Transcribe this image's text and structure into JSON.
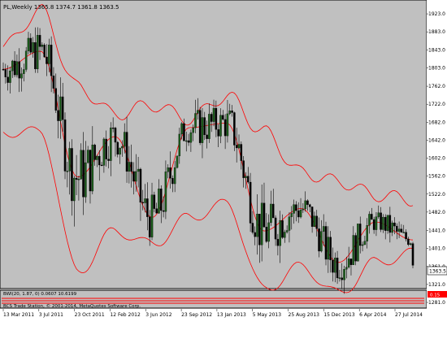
{
  "window": {
    "header": "PL,Weekly  1365.8 1374.7 1361.8 1363.5"
  },
  "indicator": {
    "header": "BWI(20, 1.87, 0) 0.0607 10.6199",
    "copyright": "BCS Trade Station, © 2001-2014, MetaQuotes Software Corp.",
    "value_badge": "0.15"
  },
  "price_axis": {
    "labels": [
      "1923.0",
      "1883.0",
      "1843.0",
      "1803.0",
      "1762.0",
      "1722.0",
      "1682.0",
      "1642.0",
      "1602.0",
      "1562.0",
      "1522.0",
      "1482.0",
      "1441.0",
      "1401.0",
      "1361.0",
      "1321.0",
      "1281.0"
    ],
    "current_price": "1363.5"
  },
  "time_axis": {
    "labels": [
      "13 Mar 2011",
      "3 Jul 2011",
      "23 Oct 2011",
      "12 Feb 2012",
      "3 Jun 2012",
      "23 Sep 2012",
      "13 Jan 2013",
      "5 May 2013",
      "25 Aug 2013",
      "15 Dec 2013",
      "6 Apr 2014",
      "27 Jul 2014"
    ]
  },
  "colors": {
    "background": "#c0c0c0",
    "bull_candle": "#00ff00",
    "bear_candle": "#ff0000",
    "bands": "#ff0000",
    "text": "#000000",
    "badge": "#ff0000"
  },
  "chart_data": {
    "type": "line",
    "title": "PL,Weekly",
    "ylim": [
      1281,
      1943
    ],
    "x": [
      "13 Mar 2011",
      "3 Jul 2011",
      "23 Oct 2011",
      "12 Feb 2012",
      "3 Jun 2012",
      "23 Sep 2012",
      "13 Jan 2013",
      "5 May 2013",
      "25 Aug 2013",
      "15 Dec 2013",
      "6 Apr 2014",
      "27 Jul 2014"
    ],
    "series": [
      {
        "values": [
          1800,
          1840,
          1560,
          1650,
          1470,
          1670,
          1680,
          1440,
          1490,
          1370,
          1460,
          1420
        ]
      },
      {
        "values": [
          1850,
          1930,
          1760,
          1700,
          1720,
          1690,
          1740,
          1660,
          1570,
          1550,
          1520,
          1510
        ]
      },
      {
        "values": [
          1660,
          1660,
          1350,
          1440,
          1410,
          1470,
          1500,
          1310,
          1360,
          1300,
          1370,
          1390
        ]
      }
    ]
  }
}
